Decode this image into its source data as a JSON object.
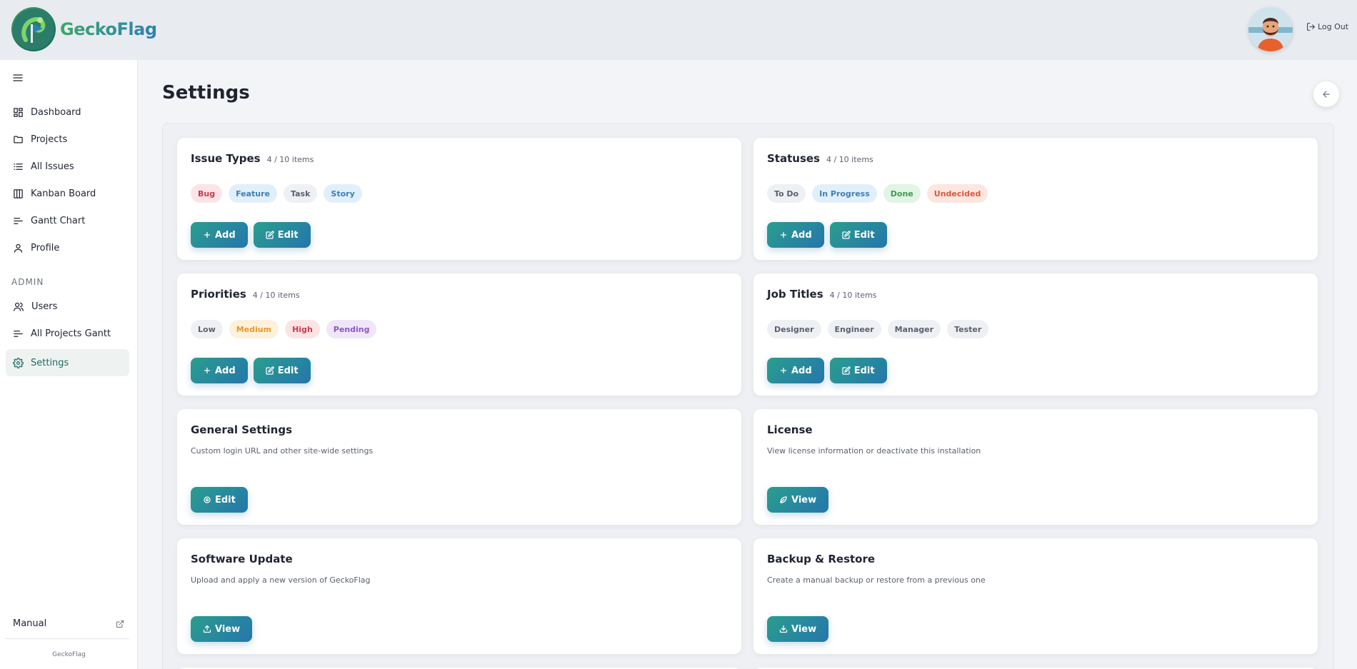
{
  "header": {
    "brand": "GeckoFlag",
    "logout_label": "Log Out"
  },
  "sidebar": {
    "items": [
      {
        "label": "Dashboard",
        "icon": "dashboard-icon"
      },
      {
        "label": "Projects",
        "icon": "folder-icon"
      },
      {
        "label": "All Issues",
        "icon": "list-icon"
      },
      {
        "label": "Kanban Board",
        "icon": "kanban-icon"
      },
      {
        "label": "Gantt Chart",
        "icon": "gantt-icon"
      },
      {
        "label": "Profile",
        "icon": "user-icon"
      }
    ],
    "admin_label": "ADMIN",
    "admin_items": [
      {
        "label": "Users",
        "icon": "users-icon"
      },
      {
        "label": "All Projects Gantt",
        "icon": "gantt-icon"
      },
      {
        "label": "Settings",
        "icon": "gear-icon",
        "active": true
      }
    ],
    "manual_label": "Manual",
    "footer": "GeckoFlag"
  },
  "page": {
    "title": "Settings"
  },
  "cards": {
    "issue_types": {
      "title": "Issue Types",
      "count": "4 / 10 items",
      "chips": [
        "Bug",
        "Feature",
        "Task",
        "Story"
      ],
      "add": "Add",
      "edit": "Edit"
    },
    "statuses": {
      "title": "Statuses",
      "count": "4 / 10 items",
      "chips": [
        "To Do",
        "In Progress",
        "Done",
        "Undecided"
      ],
      "add": "Add",
      "edit": "Edit"
    },
    "priorities": {
      "title": "Priorities",
      "count": "4 / 10 items",
      "chips": [
        "Low",
        "Medium",
        "High",
        "Pending"
      ],
      "add": "Add",
      "edit": "Edit"
    },
    "job_titles": {
      "title": "Job Titles",
      "count": "4 / 10 items",
      "chips": [
        "Designer",
        "Engineer",
        "Manager",
        "Tester"
      ],
      "add": "Add",
      "edit": "Edit"
    },
    "general": {
      "title": "General Settings",
      "desc": "Custom login URL and other site-wide settings",
      "button": "Edit"
    },
    "license": {
      "title": "License",
      "desc": "View license information or deactivate this installation",
      "button": "View"
    },
    "software_update": {
      "title": "Software Update",
      "desc": "Upload and apply a new version of GeckoFlag",
      "button": "View"
    },
    "backup": {
      "title": "Backup & Restore",
      "desc": "Create a manual backup or restore from a previous one",
      "button": "View"
    }
  },
  "colors": {
    "accent_start": "#2a9e8e",
    "accent_end": "#2576ac",
    "active_nav": "#1a6d62"
  }
}
